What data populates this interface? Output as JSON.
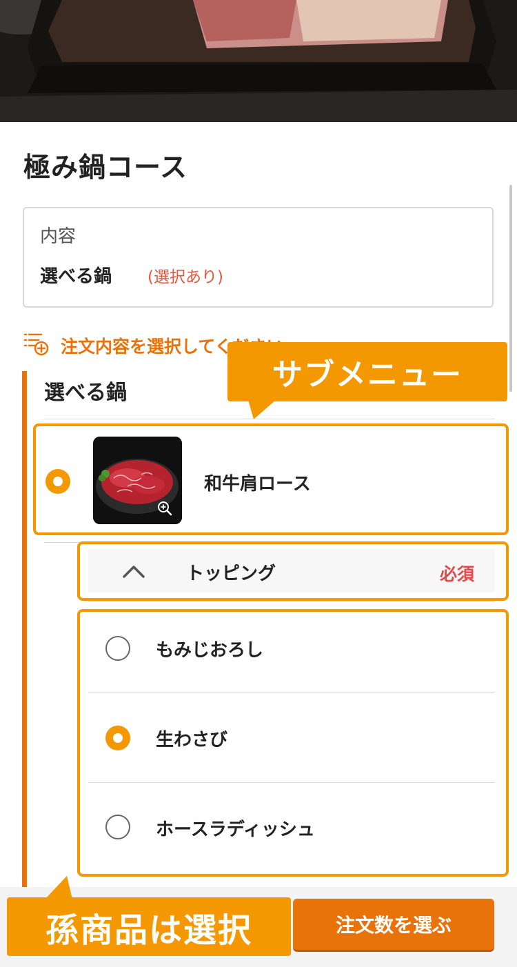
{
  "course": {
    "title": "極み鍋コース",
    "content_label": "内容",
    "content_item": "選べる鍋",
    "content_note": "(選択あり)"
  },
  "selection": {
    "prompt": "注文内容を選択してください",
    "group_title": "選べる鍋",
    "main_item": "和牛肩ロース"
  },
  "topping": {
    "header": "トッピング",
    "required": "必須",
    "options": [
      {
        "label": "もみじおろし",
        "selected": false
      },
      {
        "label": "生わさび",
        "selected": true
      },
      {
        "label": "ホースラディッシュ",
        "selected": false
      }
    ]
  },
  "callouts": {
    "submenu": "サブメニュー",
    "grandchild": "孫商品は選択"
  },
  "footer": {
    "order_button": "注文数を選ぶ"
  },
  "colors": {
    "accent": "#f39800",
    "accent_dark": "#e8730a",
    "required": "#e04a4a"
  }
}
